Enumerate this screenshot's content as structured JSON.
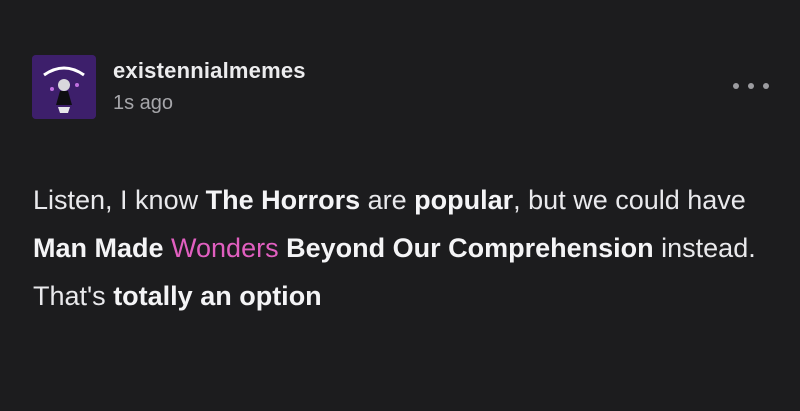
{
  "post": {
    "username": "existennialmemes",
    "timestamp": "1s ago",
    "more_menu": "more-horizontal-icon",
    "avatar_icon": "avatar-illustration",
    "body": {
      "seg1": "Listen, I know ",
      "seg2": "The Horrors",
      "seg3": " are ",
      "seg4": "popular",
      "seg5": ", but we could have ",
      "seg6": "Man Made ",
      "seg7": "Wonders",
      "seg8": " Beyond Our Comprehension",
      "seg9": " instead. That's ",
      "seg10": "totally an option"
    }
  },
  "colors": {
    "background": "#1c1c1e",
    "text": "#e9e9ec",
    "muted": "#a6a6aa",
    "highlight_pink": "#e15fc0",
    "avatar_bg": "#3d1f6b"
  }
}
